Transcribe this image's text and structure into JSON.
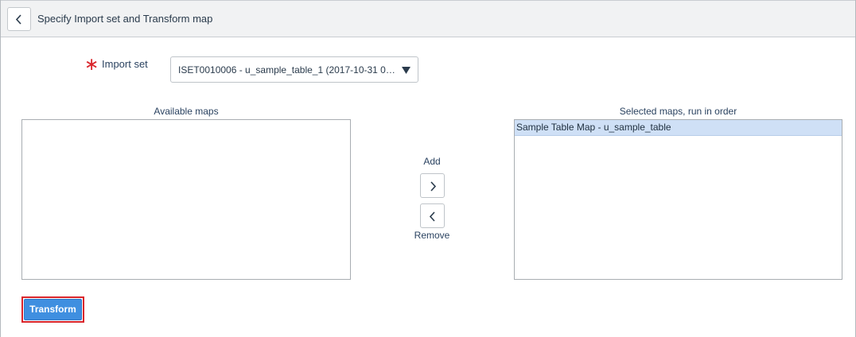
{
  "header": {
    "title": "Specify Import set and Transform map",
    "back_icon": "chevron-left-icon"
  },
  "form": {
    "required_marker": "∗",
    "import_set_label": "Import set",
    "import_set_value": "ISET0010006 - u_sample_table_1 (2017-10-31 05:...",
    "select_arrow": "▼"
  },
  "maps": {
    "available_label": "Available maps",
    "available_items": [],
    "selected_label": "Selected maps, run in order",
    "selected_items": [
      "Sample Table Map - u_sample_table"
    ]
  },
  "actions": {
    "add_label": "Add",
    "remove_label": "Remove",
    "transform_label": "Transform"
  },
  "colors": {
    "accent": "#3f8fe0",
    "required": "#d9252b",
    "selected_row": "#cfe0f6"
  }
}
